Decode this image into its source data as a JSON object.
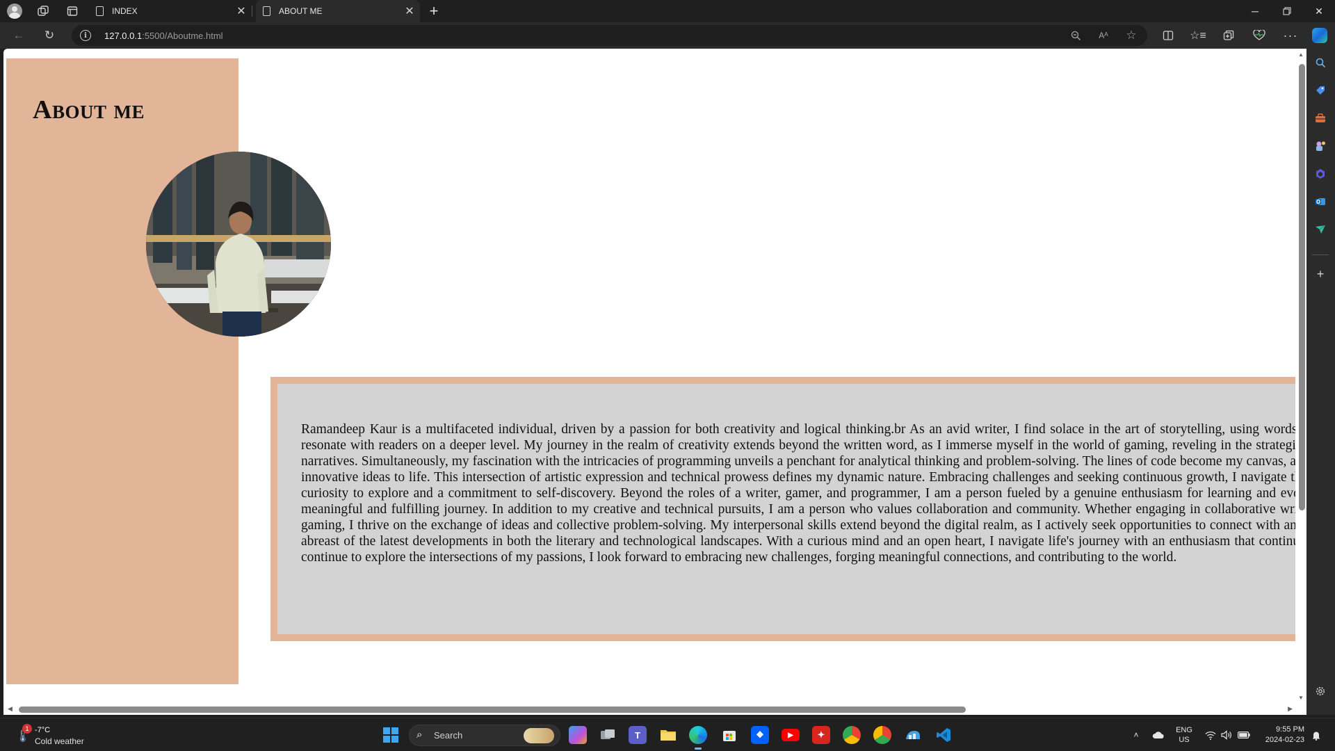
{
  "browser": {
    "tabs": [
      {
        "label": "INDEX",
        "active": false
      },
      {
        "label": "ABOUT ME",
        "active": true
      }
    ],
    "address": {
      "host": "127.0.0.1",
      "path": ":5500/Aboutme.html"
    },
    "toolbar_icons": [
      "zoom-out-icon",
      "read-aloud-icon",
      "favorite-star-icon",
      "split-screen-icon",
      "favorites-icon",
      "collections-icon",
      "browser-essentials-icon",
      "more-icon",
      "copilot-icon"
    ],
    "sidebar_icons": [
      "search-icon",
      "shopping-icon",
      "tools-icon",
      "games-icon",
      "microsoft-365-icon",
      "outlook-icon",
      "drop-icon",
      "add-icon",
      "settings-icon"
    ],
    "aa_label": "Aᴬ"
  },
  "page": {
    "title": "About me",
    "photo_alt": "Portrait photo",
    "bio": "Ramandeep Kaur is a multifaceted individual, driven by a passion for both creativity and logical thinking.br As an avid writer, I find solace in the art of storytelling, using words to create vivid worlds that resonate with readers on a deeper level. My journey in the realm of creativity extends beyond the written word, as I immerse myself in the world of gaming, reveling in the strategic challenges and immersive narratives. Simultaneously, my fascination with the intricacies of programming unveils a penchant for analytical thinking and problem-solving. The lines of code become my canvas, and I take delight in bringing innovative ideas to life. This intersection of artistic expression and technical prowess defines my dynamic nature. Embracing challenges and seeking continuous growth, I navigate through life with a relentless curiosity to explore and a commitment to self-discovery. Beyond the roles of a writer, gamer, and programmer, I am a person fueled by a genuine enthusiasm for learning and evolving, making every step a meaningful and fulfilling journey. In addition to my creative and technical pursuits, I am a person who values collaboration and community. Whether engaging in collaborative writing projects or team-based gaming, I thrive on the exchange of ideas and collective problem-solving. My interpersonal skills extend beyond the digital realm, as I actively seek opportunities to connect with and learn from others, staying abreast of the latest developments in both the literary and technological landscapes. With a curious mind and an open heart, I navigate life's journey with an enthusiasm that continues to shape who I am. As I continue to explore the intersections of my passions, I look forward to embracing new challenges, forging meaningful connections, and contributing to the world."
  },
  "taskbar": {
    "weather": {
      "badge": "1",
      "temp": "-7°C",
      "desc": "Cold weather"
    },
    "search_placeholder": "Search",
    "lang": {
      "line1": "ENG",
      "line2": "US"
    },
    "time": "9:55 PM",
    "date": "2024-02-23"
  },
  "colors": {
    "panel": "#e2b598",
    "textbox": "#d3d3d3"
  }
}
